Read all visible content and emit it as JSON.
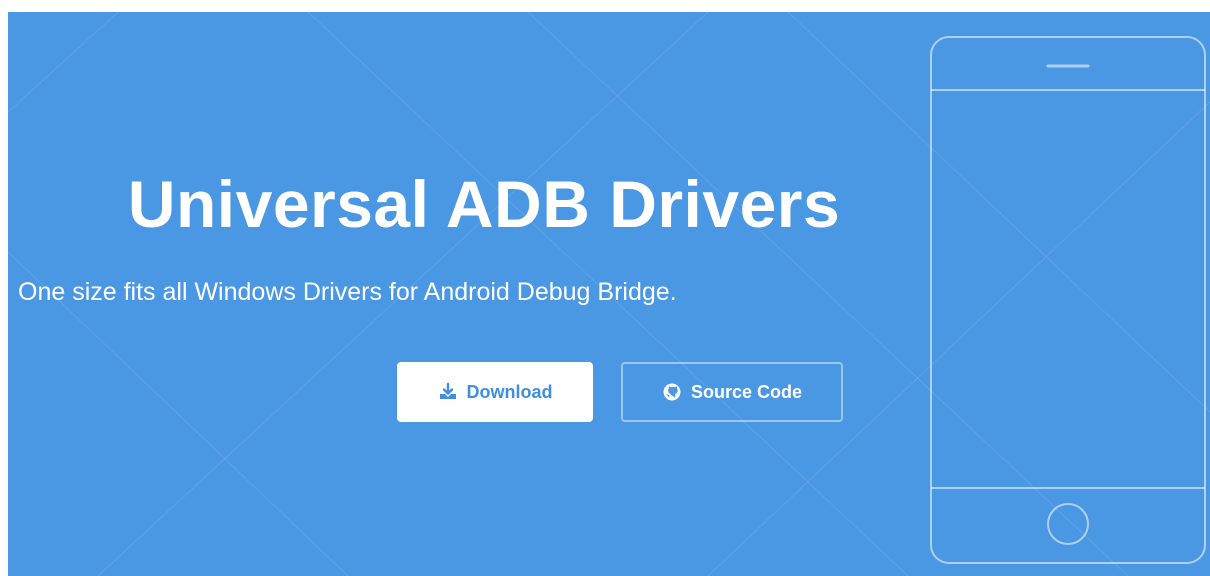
{
  "hero": {
    "title": "Universal ADB Drivers",
    "subtitle": "One size fits all Windows Drivers for Android Debug Bridge.",
    "background_color": "#4a97e3"
  },
  "buttons": {
    "download": {
      "label": "Download",
      "icon": "download-icon",
      "background": "#ffffff",
      "text_color": "#3f8ee0"
    },
    "source_code": {
      "label": "Source Code",
      "icon": "github-icon"
    }
  },
  "decoration": {
    "phone_outline": "phone-outline-icon"
  }
}
